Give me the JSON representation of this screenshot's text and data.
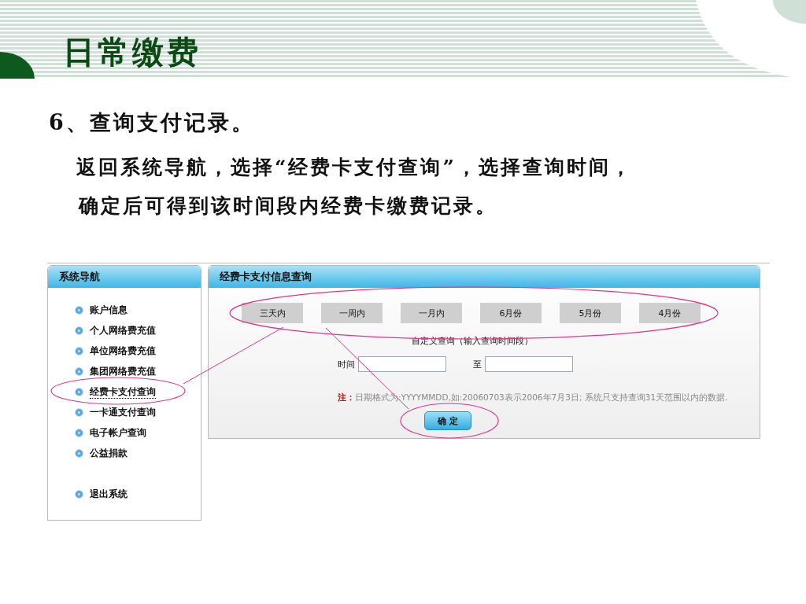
{
  "slide": {
    "title": "日常缴费",
    "heading": "6、查询支付记录。",
    "paragraph": [
      "返回系统导航，选择“经费卡支付查询”，选择查询时间，",
      "确定后可得到该时间段内经费卡缴费记录。"
    ]
  },
  "nav": {
    "title": "系统导航",
    "items": [
      {
        "label": "账户信息",
        "kind": "link",
        "selected": false
      },
      {
        "label": "个人网络费充值",
        "kind": "link",
        "selected": false
      },
      {
        "label": "单位网络费充值",
        "kind": "link",
        "selected": false
      },
      {
        "label": "集团网络费充值",
        "kind": "link",
        "selected": false
      },
      {
        "label": "经费卡支付查询",
        "kind": "link",
        "selected": true
      },
      {
        "label": "一卡通支付查询",
        "kind": "link",
        "selected": false
      },
      {
        "label": "电子帐户查询",
        "kind": "link",
        "selected": false
      },
      {
        "label": "公益捐款",
        "kind": "link",
        "selected": false
      },
      {
        "label": "退出系统",
        "kind": "exit",
        "selected": false
      }
    ]
  },
  "panel": {
    "title": "经费卡支付信息查询",
    "quick_buttons": [
      "三天内",
      "一周内",
      "一月内",
      "6月份",
      "5月份",
      "4月份"
    ],
    "custom_label": "自定义查询（输入查询时间段）",
    "time_label": "时间",
    "to_label": "至",
    "note_label": "注：",
    "note": "日期格式为:YYYYMMDD,如:20060703表示2006年7月3日; 系统只支持查询31天范围以内的数据.",
    "confirm": "确 定"
  }
}
